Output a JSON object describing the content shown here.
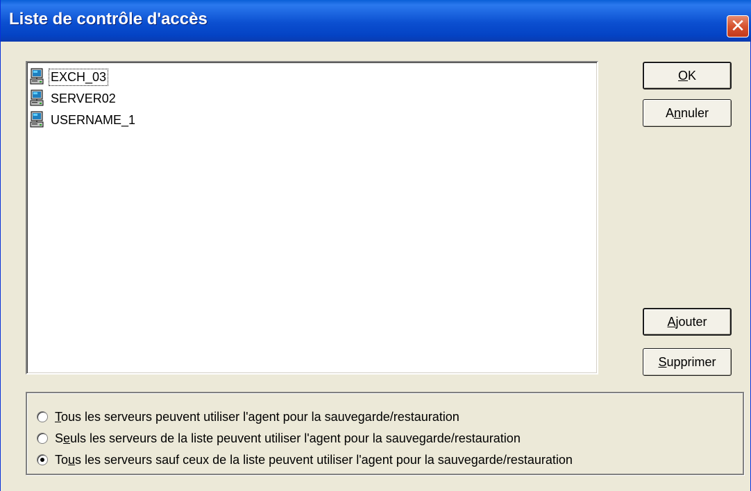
{
  "window": {
    "title": "Liste de contrôle d'accès",
    "close_glyph": "✕"
  },
  "list": {
    "items": [
      {
        "label": "EXCH_03",
        "icon": "computer-icon",
        "focused": true
      },
      {
        "label": "SERVER02",
        "icon": "computer-icon",
        "focused": false
      },
      {
        "label": "USERNAME_1",
        "icon": "computer-icon",
        "focused": false
      }
    ]
  },
  "buttons": {
    "ok": {
      "mnemonic": "O",
      "rest": "K"
    },
    "cancel": {
      "pre": "A",
      "mnemonic": "n",
      "rest": "nuler"
    },
    "add": {
      "mnemonic": "A",
      "rest": "jouter"
    },
    "remove": {
      "mnemonic": "S",
      "rest": "upprimer"
    }
  },
  "options": [
    {
      "pre": "",
      "mnemonic": "T",
      "rest": "ous les serveurs peuvent utiliser l'agent pour la sauvegarde/restauration",
      "checked": false
    },
    {
      "pre": "S",
      "mnemonic": "e",
      "rest": "uls les serveurs de la liste peuvent utiliser l'agent pour la sauvegarde/restauration",
      "checked": false
    },
    {
      "pre": "To",
      "mnemonic": "u",
      "rest": "s les serveurs sauf ceux de la liste peuvent utiliser l'agent pour la sauvegarde/restauration",
      "checked": true
    }
  ],
  "colors": {
    "titlebar": "#0b4fd0",
    "face": "#ece9d8",
    "close": "#d7532f"
  }
}
